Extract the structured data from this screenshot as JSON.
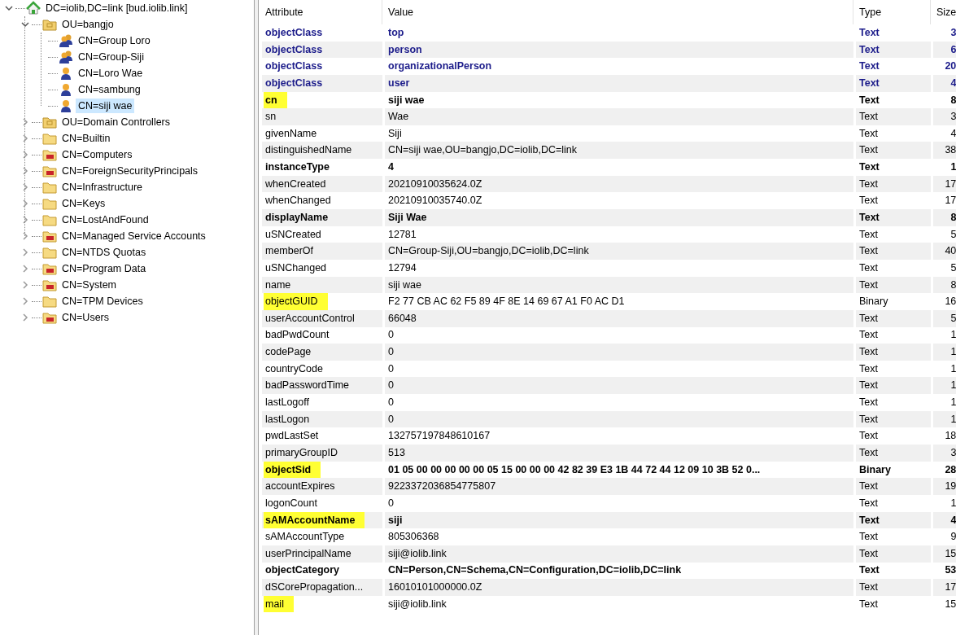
{
  "tree": [
    {
      "label": "DC=iolib,DC=link [bud.iolib.link]",
      "kind": "domain",
      "expanded": true,
      "selected": false,
      "children": [
        {
          "label": "OU=bangjo",
          "kind": "ou",
          "expanded": true,
          "selected": false,
          "children": [
            {
              "label": "CN=Group Loro",
              "kind": "group",
              "selected": false
            },
            {
              "label": "CN=Group-Siji",
              "kind": "group",
              "selected": false
            },
            {
              "label": "CN=Loro Wae",
              "kind": "user",
              "selected": false
            },
            {
              "label": "CN=sambung",
              "kind": "user",
              "selected": false
            },
            {
              "label": "CN=siji wae",
              "kind": "user",
              "selected": true
            }
          ]
        },
        {
          "label": "OU=Domain Controllers",
          "kind": "ou",
          "expanded": false,
          "selected": false
        },
        {
          "label": "CN=Builtin",
          "kind": "container",
          "expanded": false,
          "selected": false
        },
        {
          "label": "CN=Computers",
          "kind": "special",
          "expanded": false,
          "selected": false
        },
        {
          "label": "CN=ForeignSecurityPrincipals",
          "kind": "special",
          "expanded": false,
          "selected": false
        },
        {
          "label": "CN=Infrastructure",
          "kind": "container",
          "expanded": false,
          "selected": false
        },
        {
          "label": "CN=Keys",
          "kind": "container",
          "expanded": false,
          "selected": false
        },
        {
          "label": "CN=LostAndFound",
          "kind": "container",
          "expanded": false,
          "selected": false
        },
        {
          "label": "CN=Managed Service Accounts",
          "kind": "special",
          "expanded": false,
          "selected": false
        },
        {
          "label": "CN=NTDS Quotas",
          "kind": "container",
          "expanded": false,
          "selected": false
        },
        {
          "label": "CN=Program Data",
          "kind": "special",
          "expanded": false,
          "selected": false
        },
        {
          "label": "CN=System",
          "kind": "special",
          "expanded": false,
          "selected": false
        },
        {
          "label": "CN=TPM Devices",
          "kind": "container",
          "expanded": false,
          "selected": false
        },
        {
          "label": "CN=Users",
          "kind": "special",
          "expanded": false,
          "selected": false
        }
      ]
    }
  ],
  "table": {
    "columns": [
      "Attribute",
      "Value",
      "Type",
      "Size"
    ],
    "rows": [
      {
        "kind": "class",
        "highlighted": false,
        "cells": [
          "objectClass",
          "top",
          "Text",
          "3"
        ]
      },
      {
        "kind": "class",
        "highlighted": false,
        "cells": [
          "objectClass",
          "person",
          "Text",
          "6"
        ]
      },
      {
        "kind": "class",
        "highlighted": false,
        "cells": [
          "objectClass",
          "organizationalPerson",
          "Text",
          "20"
        ]
      },
      {
        "kind": "class",
        "highlighted": false,
        "cells": [
          "objectClass",
          "user",
          "Text",
          "4"
        ]
      },
      {
        "kind": "bold",
        "highlighted": true,
        "cells": [
          "cn",
          "siji wae",
          "Text",
          "8"
        ]
      },
      {
        "kind": "plain",
        "highlighted": false,
        "cells": [
          "sn",
          "Wae",
          "Text",
          "3"
        ]
      },
      {
        "kind": "plain",
        "highlighted": false,
        "cells": [
          "givenName",
          "Siji",
          "Text",
          "4"
        ]
      },
      {
        "kind": "plain",
        "highlighted": false,
        "cells": [
          "distinguishedName",
          "CN=siji wae,OU=bangjo,DC=iolib,DC=link",
          "Text",
          "38"
        ]
      },
      {
        "kind": "bold",
        "highlighted": false,
        "cells": [
          "instanceType",
          "4",
          "Text",
          "1"
        ]
      },
      {
        "kind": "plain",
        "highlighted": false,
        "cells": [
          "whenCreated",
          "20210910035624.0Z",
          "Text",
          "17"
        ]
      },
      {
        "kind": "plain",
        "highlighted": false,
        "cells": [
          "whenChanged",
          "20210910035740.0Z",
          "Text",
          "17"
        ]
      },
      {
        "kind": "bold",
        "highlighted": false,
        "cells": [
          "displayName",
          "Siji Wae",
          "Text",
          "8"
        ]
      },
      {
        "kind": "plain",
        "highlighted": false,
        "cells": [
          "uSNCreated",
          "12781",
          "Text",
          "5"
        ]
      },
      {
        "kind": "plain",
        "highlighted": false,
        "cells": [
          "memberOf",
          "CN=Group-Siji,OU=bangjo,DC=iolib,DC=link",
          "Text",
          "40"
        ]
      },
      {
        "kind": "plain",
        "highlighted": false,
        "cells": [
          "uSNChanged",
          "12794",
          "Text",
          "5"
        ]
      },
      {
        "kind": "plain",
        "highlighted": false,
        "cells": [
          "name",
          "siji wae",
          "Text",
          "8"
        ]
      },
      {
        "kind": "plain",
        "highlighted": true,
        "cells": [
          "objectGUID",
          "F2 77 CB AC 62 F5 89 4F 8E 14 69 67 A1 F0 AC D1",
          "Binary",
          "16"
        ]
      },
      {
        "kind": "plain",
        "highlighted": false,
        "cells": [
          "userAccountControl",
          "66048",
          "Text",
          "5"
        ]
      },
      {
        "kind": "plain",
        "highlighted": false,
        "cells": [
          "badPwdCount",
          "0",
          "Text",
          "1"
        ]
      },
      {
        "kind": "plain",
        "highlighted": false,
        "cells": [
          "codePage",
          "0",
          "Text",
          "1"
        ]
      },
      {
        "kind": "plain",
        "highlighted": false,
        "cells": [
          "countryCode",
          "0",
          "Text",
          "1"
        ]
      },
      {
        "kind": "plain",
        "highlighted": false,
        "cells": [
          "badPasswordTime",
          "0",
          "Text",
          "1"
        ]
      },
      {
        "kind": "plain",
        "highlighted": false,
        "cells": [
          "lastLogoff",
          "0",
          "Text",
          "1"
        ]
      },
      {
        "kind": "plain",
        "highlighted": false,
        "cells": [
          "lastLogon",
          "0",
          "Text",
          "1"
        ]
      },
      {
        "kind": "plain",
        "highlighted": false,
        "cells": [
          "pwdLastSet",
          "132757197848610167",
          "Text",
          "18"
        ]
      },
      {
        "kind": "plain",
        "highlighted": false,
        "cells": [
          "primaryGroupID",
          "513",
          "Text",
          "3"
        ]
      },
      {
        "kind": "bold",
        "highlighted": true,
        "cells": [
          "objectSid",
          "01 05 00 00 00 00 00 05 15 00 00 00 42 82 39 E3 1B 44 72 44 12 09 10 3B 52 0...",
          "Binary",
          "28"
        ]
      },
      {
        "kind": "plain",
        "highlighted": false,
        "cells": [
          "accountExpires",
          "9223372036854775807",
          "Text",
          "19"
        ]
      },
      {
        "kind": "plain",
        "highlighted": false,
        "cells": [
          "logonCount",
          "0",
          "Text",
          "1"
        ]
      },
      {
        "kind": "bold",
        "highlighted": true,
        "cells": [
          "sAMAccountName",
          "siji",
          "Text",
          "4"
        ]
      },
      {
        "kind": "plain",
        "highlighted": false,
        "cells": [
          "sAMAccountType",
          "805306368",
          "Text",
          "9"
        ]
      },
      {
        "kind": "plain",
        "highlighted": false,
        "cells": [
          "userPrincipalName",
          "siji@iolib.link",
          "Text",
          "15"
        ]
      },
      {
        "kind": "bold",
        "highlighted": false,
        "cells": [
          "objectCategory",
          "CN=Person,CN=Schema,CN=Configuration,DC=iolib,DC=link",
          "Text",
          "53"
        ]
      },
      {
        "kind": "plain",
        "highlighted": false,
        "cells": [
          "dSCorePropagation...",
          "16010101000000.0Z",
          "Text",
          "17"
        ]
      },
      {
        "kind": "plain",
        "highlighted": true,
        "cells": [
          "mail",
          "siji@iolib.link",
          "Text",
          "15"
        ]
      }
    ]
  }
}
